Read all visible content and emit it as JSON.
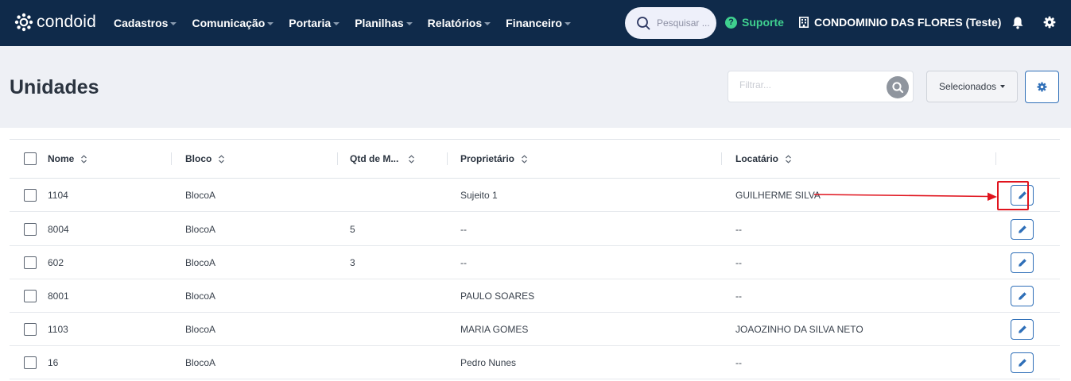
{
  "brand": {
    "name": "condoid"
  },
  "nav": [
    {
      "label": "Cadastros"
    },
    {
      "label": "Comunicação"
    },
    {
      "label": "Portaria"
    },
    {
      "label": "Planilhas"
    },
    {
      "label": "Relatórios"
    },
    {
      "label": "Financeiro"
    }
  ],
  "topbar": {
    "search_placeholder": "Pesquisar ...",
    "support_label": "Suporte",
    "condominium": "CONDOMINIO DAS FLORES (Teste)"
  },
  "page": {
    "title": "Unidades",
    "filter_placeholder": "Filtrar...",
    "selected_label": "Selecionados"
  },
  "table": {
    "columns": [
      {
        "label": "Nome"
      },
      {
        "label": "Bloco"
      },
      {
        "label": "Qtd de M..."
      },
      {
        "label": "Proprietário"
      },
      {
        "label": "Locatário"
      }
    ],
    "rows": [
      {
        "nome": "1104",
        "bloco": "BlocoA",
        "qtd": "",
        "proprietario": "Sujeito 1",
        "locatario": "GUILHERME SILVA"
      },
      {
        "nome": "8004",
        "bloco": "BlocoA",
        "qtd": "5",
        "proprietario": "--",
        "locatario": "--"
      },
      {
        "nome": "602",
        "bloco": "BlocoA",
        "qtd": "3",
        "proprietario": "--",
        "locatario": "--"
      },
      {
        "nome": "8001",
        "bloco": "BlocoA",
        "qtd": "",
        "proprietario": "PAULO SOARES",
        "locatario": "--"
      },
      {
        "nome": "1103",
        "bloco": "BlocoA",
        "qtd": "",
        "proprietario": "MARIA GOMES",
        "locatario": "JOAOZINHO DA SILVA NETO"
      },
      {
        "nome": "16",
        "bloco": "BlocoA",
        "qtd": "",
        "proprietario": "Pedro Nunes",
        "locatario": "--"
      }
    ]
  },
  "colors": {
    "topbar": "#0f2a4a",
    "accent": "#2f6fb8",
    "support": "#3fd08f",
    "annotation": "#e0141e"
  },
  "icons": {
    "logo": "condoid-logo-icon",
    "search": "search-icon",
    "support": "question-circle-icon",
    "condominium": "building-icon",
    "notifications": "bell-icon",
    "settings": "gear-icon",
    "sort": "sort-icon",
    "edit": "pencil-icon"
  }
}
